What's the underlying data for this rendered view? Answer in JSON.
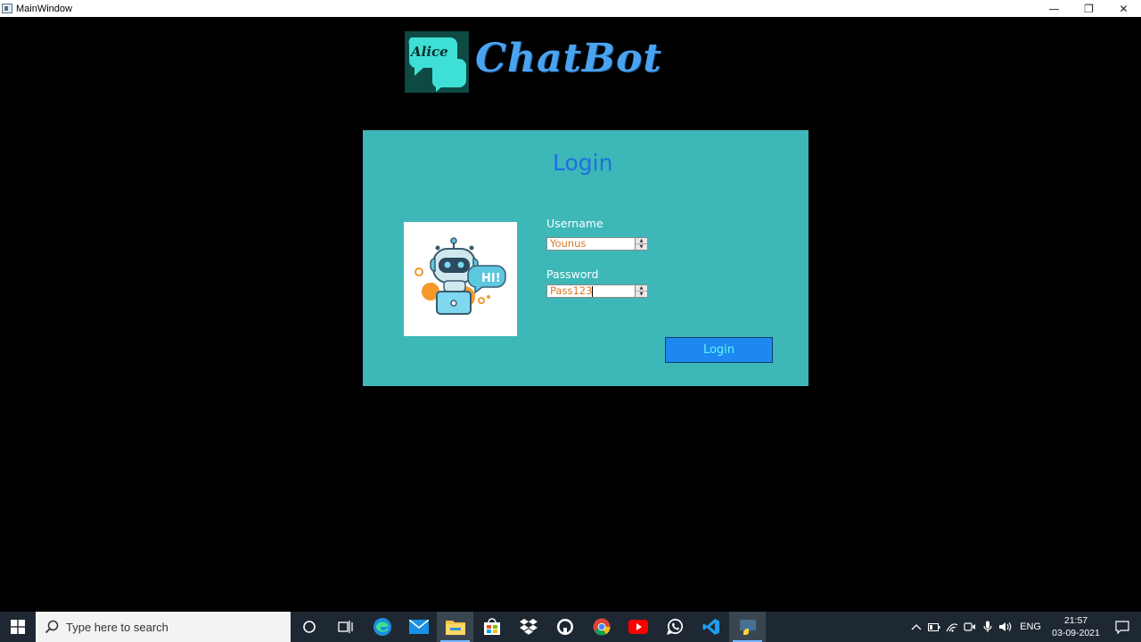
{
  "window": {
    "title": "MainWindow",
    "minimize": "—",
    "restore": "❐",
    "close": "✕"
  },
  "header": {
    "logo_text": "Alice",
    "app_name": "ChatBot"
  },
  "login": {
    "heading": "Login",
    "illustration_text": "HI!",
    "username_label": "Username",
    "username_value": "Younus",
    "password_label": "Password",
    "password_value": "Pass123",
    "submit_label": "Login"
  },
  "colors": {
    "panel_bg": "#3db7b8",
    "heading": "#1f6fe0",
    "button_bg": "#1e88f0",
    "button_text": "#5ff6ff",
    "input_text": "#d97a2b",
    "brand": "#4aa3f0"
  },
  "taskbar": {
    "search_placeholder": "Type here to search",
    "apps": [
      "cortana-icon",
      "task-view-icon",
      "edge-icon",
      "mail-icon",
      "file-explorer-icon",
      "store-icon",
      "dropbox-icon",
      "github-icon",
      "chrome-icon",
      "youtube-icon",
      "whatsapp-icon",
      "vscode-icon",
      "python-icon"
    ],
    "language": "ENG",
    "time": "21:57",
    "date": "03-09-2021"
  }
}
